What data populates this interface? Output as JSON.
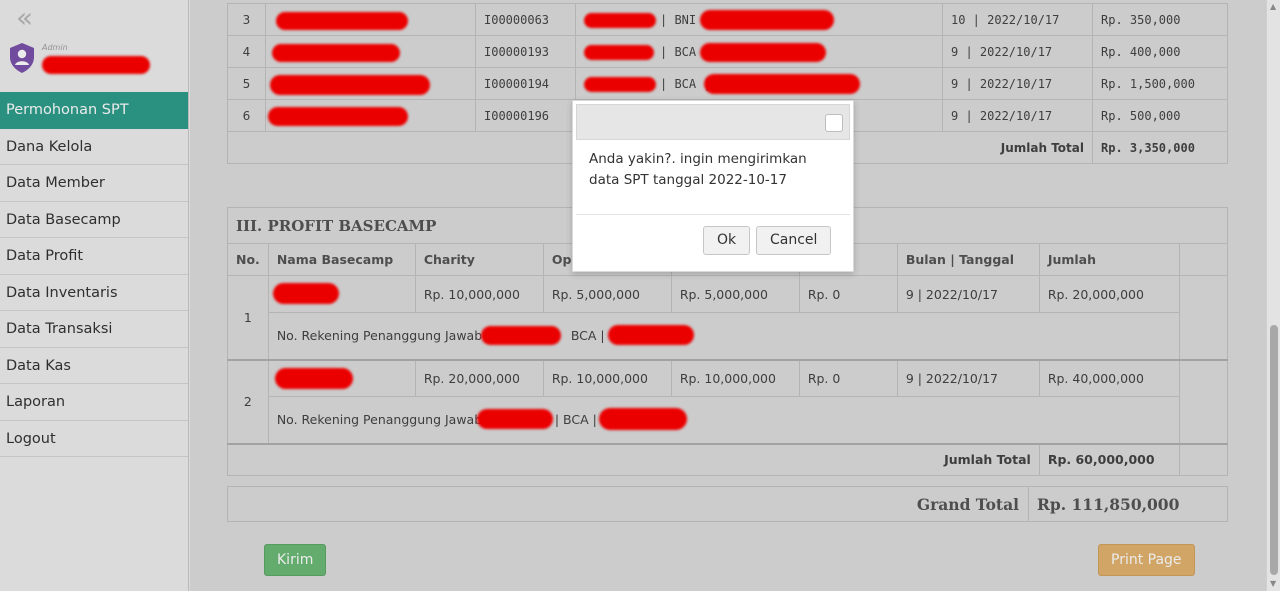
{
  "sidebar": {
    "collapse_glyph": "«",
    "role": "Admin",
    "menu": [
      {
        "label": "Permohonan SPT"
      },
      {
        "label": "Dana Kelola"
      },
      {
        "label": "Data Member"
      },
      {
        "label": "Data Basecamp"
      },
      {
        "label": "Data Profit"
      },
      {
        "label": "Data Inventaris"
      },
      {
        "label": "Data Transaksi"
      },
      {
        "label": "Data Kas"
      },
      {
        "label": "Laporan"
      },
      {
        "label": "Logout"
      }
    ]
  },
  "investor_table": {
    "rows": [
      {
        "no": "3",
        "id": "I00000063",
        "bank": "| BNI |",
        "date": "10 | 2022/10/17",
        "amount": "Rp. 350,000"
      },
      {
        "no": "4",
        "id": "I00000193",
        "bank": "| BCA |",
        "date": "9 | 2022/10/17",
        "amount": "Rp. 400,000"
      },
      {
        "no": "5",
        "id": "I00000194",
        "bank": "| BCA |",
        "date": "9 | 2022/10/17",
        "amount": "Rp. 1,500,000"
      },
      {
        "no": "6",
        "id": "I00000196",
        "bank": "",
        "date": "9 | 2022/10/17",
        "amount": "Rp. 500,000"
      }
    ],
    "total_label": "Jumlah Total",
    "total_value": "Rp. 3,350,000"
  },
  "profit_basecamp": {
    "title": "III. PROFIT BASECAMP",
    "headers": [
      "No.",
      "Nama Basecamp",
      "Charity",
      "Ope",
      "",
      "ris",
      "Bulan | Tanggal",
      "Jumlah"
    ],
    "rows": [
      {
        "no": "1",
        "charity": "Rp. 10,000,000",
        "col3": "Rp. 5,000,000",
        "col4": "Rp. 5,000,000",
        "col5": "Rp. 0",
        "date": "9 | 2022/10/17",
        "amount": "Rp. 20,000,000",
        "rekening_label": "No. Rekening Penanggung Jawab :",
        "rekening_bank": "BCA |"
      },
      {
        "no": "2",
        "charity": "Rp. 20,000,000",
        "col3": "Rp. 10,000,000",
        "col4": "Rp. 10,000,000",
        "col5": "Rp. 0",
        "date": "9 | 2022/10/17",
        "amount": "Rp. 40,000,000",
        "rekening_label": "No. Rekening Penanggung Jawab :",
        "rekening_bank": "| BCA |"
      }
    ],
    "total_label": "Jumlah Total",
    "total_value": "Rp. 60,000,000"
  },
  "grand_total": {
    "label": "Grand Total",
    "value": "Rp. 111,850,000"
  },
  "buttons": {
    "kirim": "Kirim",
    "print": "Print Page"
  },
  "dialog": {
    "message": "Anda yakin?. ingin mengirimkan data SPT tanggal 2022-10-17",
    "ok": "Ok",
    "cancel": "Cancel"
  },
  "colors": {
    "active_menu": "#2e9e8c",
    "kirim_button": "#6dbb78",
    "print_button": "#e2b36e",
    "shield": "#7b52ab",
    "redaction": "#ff0000"
  }
}
